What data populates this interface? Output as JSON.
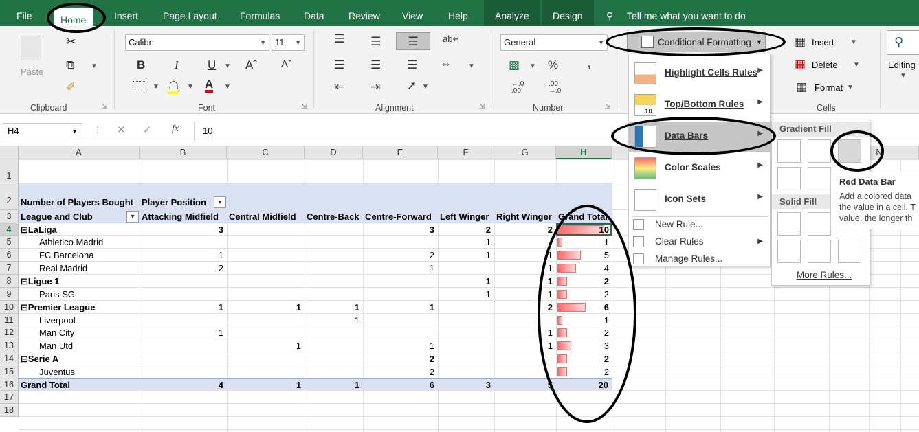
{
  "tabs": [
    "File",
    "Home",
    "Insert",
    "Page Layout",
    "Formulas",
    "Data",
    "Review",
    "View",
    "Help",
    "Analyze",
    "Design"
  ],
  "tell_me": "Tell me what you want to do",
  "ribbon": {
    "clipboard": {
      "paste": "Paste",
      "label": "Clipboard"
    },
    "font": {
      "family": "Calibri",
      "size": "11",
      "label": "Font",
      "bold": "B",
      "italic": "I",
      "underline": "U"
    },
    "alignment": {
      "label": "Alignment"
    },
    "number": {
      "format": "General",
      "label": "Number",
      "percent": "%",
      "comma": ",",
      "inc": "←.0\n.00",
      "dec": ".00\n→.0"
    },
    "styles": {
      "conditional_formatting": "Conditional Formatting"
    },
    "cells": {
      "insert": "Insert",
      "delete": "Delete",
      "format": "Format",
      "label": "Cells"
    },
    "editing": {
      "label": "Editing"
    }
  },
  "formula_bar": {
    "name_box": "H4",
    "fx": "fx",
    "value": "10"
  },
  "columns": [
    "A",
    "B",
    "C",
    "D",
    "E",
    "F",
    "G",
    "H",
    "N"
  ],
  "rows": [
    "1",
    "2",
    "3",
    "4",
    "5",
    "6",
    "7",
    "8",
    "9",
    "10",
    "11",
    "12",
    "13",
    "14",
    "15",
    "16",
    "17",
    "18"
  ],
  "pivot": {
    "row2": {
      "a": "Number of Players Bought",
      "b": "Player Position"
    },
    "header": {
      "a": "League and Club",
      "b": "Attacking Midfield",
      "c": "Central Midfield",
      "d": "Centre-Back",
      "e": "Centre-Forward",
      "f": "Left Winger",
      "g": "Right Winger",
      "h": "Grand Total"
    },
    "rows": [
      {
        "label": "LaLiga",
        "group": true,
        "b": "3",
        "c": "",
        "d": "",
        "e": "3",
        "f": "2",
        "g": "2",
        "h": "10",
        "v": 10
      },
      {
        "label": "Athletico Madrid",
        "group": false,
        "b": "",
        "c": "",
        "d": "",
        "e": "",
        "f": "1",
        "g": "",
        "h": "1",
        "v": 1
      },
      {
        "label": "FC Barcelona",
        "group": false,
        "b": "1",
        "c": "",
        "d": "",
        "e": "2",
        "f": "1",
        "g": "1",
        "h": "5",
        "v": 5
      },
      {
        "label": "Real Madrid",
        "group": false,
        "b": "2",
        "c": "",
        "d": "",
        "e": "1",
        "f": "",
        "g": "1",
        "h": "4",
        "v": 4
      },
      {
        "label": "Ligue 1",
        "group": true,
        "b": "",
        "c": "",
        "d": "",
        "e": "",
        "f": "1",
        "g": "1",
        "h": "2",
        "v": 2
      },
      {
        "label": "Paris SG",
        "group": false,
        "b": "",
        "c": "",
        "d": "",
        "e": "",
        "f": "1",
        "g": "1",
        "h": "2",
        "v": 2
      },
      {
        "label": "Premier League",
        "group": true,
        "b": "1",
        "c": "1",
        "d": "1",
        "e": "1",
        "f": "",
        "g": "2",
        "h": "6",
        "v": 6
      },
      {
        "label": "Liverpool",
        "group": false,
        "b": "",
        "c": "",
        "d": "1",
        "e": "",
        "f": "",
        "g": "",
        "h": "1",
        "v": 1
      },
      {
        "label": "Man City",
        "group": false,
        "b": "1",
        "c": "",
        "d": "",
        "e": "",
        "f": "",
        "g": "1",
        "h": "2",
        "v": 2
      },
      {
        "label": "Man Utd",
        "group": false,
        "b": "",
        "c": "1",
        "d": "",
        "e": "1",
        "f": "",
        "g": "1",
        "h": "3",
        "v": 3
      },
      {
        "label": "Serie A",
        "group": true,
        "b": "",
        "c": "",
        "d": "",
        "e": "2",
        "f": "",
        "g": "",
        "h": "2",
        "v": 2
      },
      {
        "label": "Juventus",
        "group": false,
        "b": "",
        "c": "",
        "d": "",
        "e": "2",
        "f": "",
        "g": "",
        "h": "2",
        "v": 2
      }
    ],
    "total": {
      "label": "Grand Total",
      "b": "4",
      "c": "1",
      "d": "1",
      "e": "6",
      "f": "3",
      "g": "5",
      "h": "20"
    }
  },
  "cf_menu": {
    "items": [
      "Highlight Cells Rules",
      "Top/Bottom Rules",
      "Data Bars",
      "Color Scales",
      "Icon Sets"
    ],
    "small": [
      "New Rule...",
      "Clear Rules",
      "Manage Rules..."
    ],
    "top_bottom_badge": "10"
  },
  "databars_sub": {
    "gradient": "Gradient Fill",
    "solid": "Solid Fill",
    "more": "More Rules..."
  },
  "tooltip": {
    "title": "Red Data Bar",
    "lines": [
      "Add a colored data",
      "the value in a cell. T",
      "value, the longer th"
    ]
  },
  "colors": {
    "excel_green": "#217346",
    "red_bar": "#f8696b",
    "pivot_band": "#d9e1f2"
  }
}
